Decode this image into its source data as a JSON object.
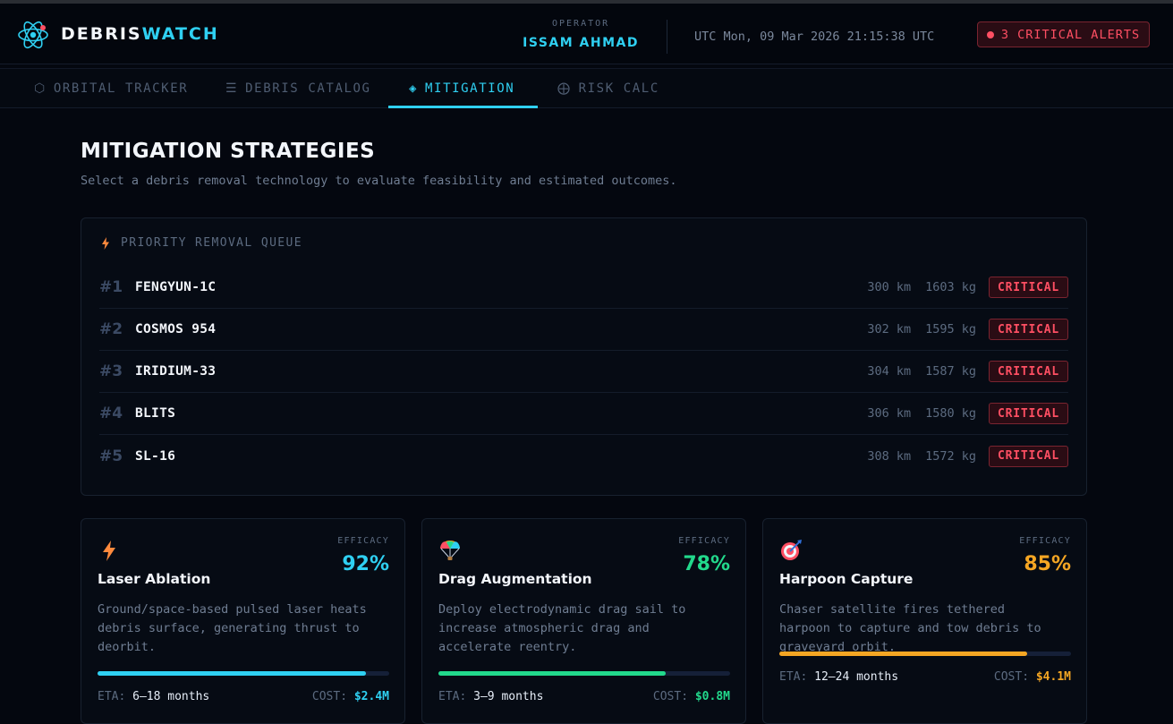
{
  "app": {
    "brand_part1": "DEBRIS",
    "brand_part2": "WATCH",
    "operator_label": "OPERATOR",
    "operator_name": "ISSAM AHMAD",
    "clock": "UTC Mon, 09 Mar 2026 21:15:38 UTC",
    "alerts_label": "3 CRITICAL ALERTS"
  },
  "colors": {
    "accent": "#2fd0f2",
    "critical": "#ff4f63",
    "green": "#22d98c",
    "amber": "#f5a623",
    "orange": "#ff8a3d"
  },
  "tabs": [
    {
      "label": "ORBITAL TRACKER",
      "icon": "hexagon-icon"
    },
    {
      "label": "DEBRIS CATALOG",
      "icon": "list-icon"
    },
    {
      "label": "MITIGATION",
      "icon": "diamond-icon",
      "active": true
    },
    {
      "label": "RISK CALC",
      "icon": "crosshair-icon"
    }
  ],
  "main": {
    "title": "MITIGATION STRATEGIES",
    "subtitle": "Select a debris removal technology to evaluate feasibility and estimated outcomes."
  },
  "queue": {
    "title": "PRIORITY REMOVAL QUEUE",
    "icon": "lightning-icon",
    "items": [
      {
        "rank": "#1",
        "name": "FENGYUN-1C",
        "altitude": "300 km",
        "mass": "1603 kg",
        "status": "CRITICAL"
      },
      {
        "rank": "#2",
        "name": "COSMOS 954",
        "altitude": "302 km",
        "mass": "1595 kg",
        "status": "CRITICAL"
      },
      {
        "rank": "#3",
        "name": "IRIDIUM-33",
        "altitude": "304 km",
        "mass": "1587 kg",
        "status": "CRITICAL"
      },
      {
        "rank": "#4",
        "name": "BLITS",
        "altitude": "306 km",
        "mass": "1580 kg",
        "status": "CRITICAL"
      },
      {
        "rank": "#5",
        "name": "SL-16",
        "altitude": "308 km",
        "mass": "1572 kg",
        "status": "CRITICAL"
      }
    ]
  },
  "strategies": [
    {
      "icon": "lightning-icon",
      "title": "Laser Ablation",
      "efficacy_label": "EFFICACY",
      "efficacy": "92%",
      "efficacy_value": 0.92,
      "description": "Ground/space-based pulsed laser heats debris surface, generating thrust to deorbit.",
      "eta_label": "ETA:",
      "eta": "6–18 months",
      "cost_label": "COST:",
      "cost": "$2.4M",
      "color": "#2fd0f2"
    },
    {
      "icon": "parachute-icon",
      "title": "Drag Augmentation",
      "efficacy_label": "EFFICACY",
      "efficacy": "78%",
      "efficacy_value": 0.78,
      "description": "Deploy electrodynamic drag sail to increase atmospheric drag and accelerate reentry.",
      "eta_label": "ETA:",
      "eta": "3–9 months",
      "cost_label": "COST:",
      "cost": "$0.8M",
      "color": "#22d98c"
    },
    {
      "icon": "target-dart-icon",
      "title": "Harpoon Capture",
      "efficacy_label": "EFFICACY",
      "efficacy": "85%",
      "efficacy_value": 0.85,
      "description": "Chaser satellite fires tethered harpoon to capture and tow debris to graveyard orbit.",
      "eta_label": "ETA:",
      "eta": "12–24 months",
      "cost_label": "COST:",
      "cost": "$4.1M",
      "color": "#f5a623"
    }
  ]
}
